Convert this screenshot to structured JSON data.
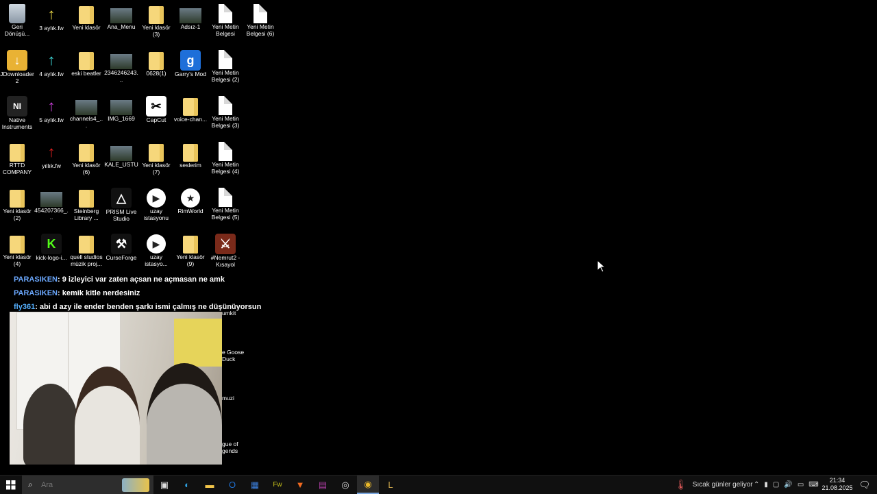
{
  "desktop": {
    "icons": [
      {
        "label": "Geri Dönüşü...",
        "icon": "recycle-bin-icon"
      },
      {
        "label": "3 aylık.fw",
        "icon": "yellow-arrow-icon"
      },
      {
        "label": "Yeni klasör",
        "icon": "folder-icon"
      },
      {
        "label": "Ana_Menu",
        "icon": "image-icon"
      },
      {
        "label": "Yeni klasör (3)",
        "icon": "folder-icon"
      },
      {
        "label": "Adsız-1",
        "icon": "image-icon"
      },
      {
        "label": "Yeni Metin Belgesi",
        "icon": "text-document-icon"
      },
      {
        "label": "Yeni Metin Belgesi (6)",
        "icon": "text-document-icon"
      },
      {
        "label": "JDownloader 2",
        "icon": "jdownloader-icon"
      },
      {
        "label": "4 aylık.fw",
        "icon": "cyan-arrow-icon"
      },
      {
        "label": "eski beatler",
        "icon": "folder-icon"
      },
      {
        "label": "2346246243...",
        "icon": "image-icon"
      },
      {
        "label": "0628(1)",
        "icon": "folder-icon"
      },
      {
        "label": "Garry's Mod",
        "icon": "garrys-mod-icon"
      },
      {
        "label": "Yeni Metin Belgesi (2)",
        "icon": "text-document-icon"
      },
      {
        "label": "Native Instruments",
        "icon": "native-instruments-icon"
      },
      {
        "label": "5 aylık.fw",
        "icon": "magenta-arrow-icon"
      },
      {
        "label": "channels4_...",
        "icon": "image-icon"
      },
      {
        "label": "IMG_1669",
        "icon": "image-icon"
      },
      {
        "label": "CapCut",
        "icon": "capcut-icon"
      },
      {
        "label": "voice-chan...",
        "icon": "folder-icon"
      },
      {
        "label": "Yeni Metin Belgesi (3)",
        "icon": "text-document-icon"
      },
      {
        "label": "RTTD COMPANY",
        "icon": "folder-icon"
      },
      {
        "label": "yıllık.fw",
        "icon": "red-arrow-icon"
      },
      {
        "label": "Yeni klasör (6)",
        "icon": "folder-icon"
      },
      {
        "label": "KALE_USTU",
        "icon": "image-icon"
      },
      {
        "label": "Yeni klasör (7)",
        "icon": "folder-icon"
      },
      {
        "label": "seslerim",
        "icon": "folder-icon"
      },
      {
        "label": "Yeni Metin Belgesi (4)",
        "icon": "text-document-icon"
      },
      {
        "label": "Yeni klasör (2)",
        "icon": "folder-icon"
      },
      {
        "label": "454207366_...",
        "icon": "image-icon"
      },
      {
        "label": "Steinberg Library ...",
        "icon": "folder-icon"
      },
      {
        "label": "PRISM Live Studio",
        "icon": "prism-icon"
      },
      {
        "label": "uzay istasyonu",
        "icon": "video-icon"
      },
      {
        "label": "RimWorld",
        "icon": "rimworld-icon"
      },
      {
        "label": "Yeni Metin Belgesi (5)",
        "icon": "text-document-icon"
      },
      {
        "label": "Yeni klasör (4)",
        "icon": "folder-icon"
      },
      {
        "label": "kick-logo-i...",
        "icon": "kick-logo-icon"
      },
      {
        "label": "quell studios müzik proj...",
        "icon": "folder-icon"
      },
      {
        "label": "CurseForge",
        "icon": "curseforge-icon"
      },
      {
        "label": "uzay istasyo...",
        "icon": "video-icon"
      },
      {
        "label": "Yeni klasör (9)",
        "icon": "folder-icon"
      },
      {
        "label": "#Nemrut2 - Kısayol",
        "icon": "game-shortcut-icon"
      }
    ],
    "partial_labels": [
      "umkit",
      "e Goose Duck",
      "muzi",
      "gue of gends"
    ]
  },
  "chat": [
    {
      "user": "PARASIKEN",
      "message": ": 9 izleyici var zaten açsan ne açmasan ne amk"
    },
    {
      "user": "PARASIKEN",
      "message": ": kemik kitle nerdesiniz"
    },
    {
      "user": "fly361",
      "message": ": abi d azy ile ender benden şarkı ismi çalmış ne düşünüyorsun"
    }
  ],
  "taskbar": {
    "search_placeholder": "Ara",
    "weather_text": "Sıcak günler geliyor",
    "time": "21:34",
    "date": "21.08.2025",
    "pinned": [
      "task-view-icon",
      "edge-icon",
      "file-explorer-icon",
      "outlook-icon",
      "store-icon",
      "fireworks-icon",
      "brave-icon",
      "winrar-icon",
      "obs-icon",
      "chrome-icon",
      "league-icon"
    ]
  }
}
